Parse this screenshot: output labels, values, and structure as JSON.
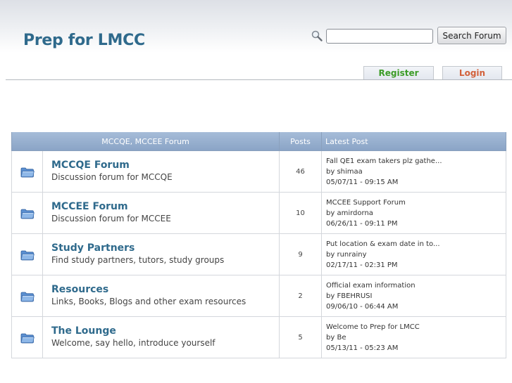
{
  "header": {
    "site_title": "Prep for LMCC",
    "search": {
      "placeholder": "",
      "value": "",
      "button_label": "Search Forum"
    },
    "nav": {
      "register_label": "Register",
      "login_label": "Login"
    }
  },
  "forum_table": {
    "columns": {
      "forum": "MCCQE, MCCEE Forum",
      "posts": "Posts",
      "latest": "Latest Post"
    },
    "rows": [
      {
        "name": "MCCQE Forum",
        "description": "Discussion forum for MCCQE",
        "posts": "46",
        "latest": {
          "title": "Fall QE1 exam takers plz gathe...",
          "author": "by shimaa",
          "datetime": "05/07/11 - 09:15 AM"
        }
      },
      {
        "name": "MCCEE Forum",
        "description": "Discussion forum for MCCEE",
        "posts": "10",
        "latest": {
          "title": "MCCEE Support Forum",
          "author": "by amirdorna",
          "datetime": "06/26/11 - 09:11 PM"
        }
      },
      {
        "name": "Study Partners",
        "description": "Find study partners, tutors, study groups",
        "posts": "9",
        "latest": {
          "title": "Put location & exam date in to...",
          "author": "by runrainy",
          "datetime": "02/17/11 - 02:31 PM"
        }
      },
      {
        "name": "Resources",
        "description": "Links, Books, Blogs and other exam resources",
        "posts": "2",
        "latest": {
          "title": "Official exam information",
          "author": "by FBEHRUSI",
          "datetime": "09/06/10 - 06:44 AM"
        }
      },
      {
        "name": "The Lounge",
        "description": "Welcome, say hello, introduce yourself",
        "posts": "5",
        "latest": {
          "title": "Welcome to Prep for LMCC",
          "author": "by Be",
          "datetime": "05/13/11 - 05:23 AM"
        }
      }
    ]
  },
  "colors": {
    "title_blue": "#2f6a8c",
    "register_green": "#3c9c27",
    "login_orange": "#d2603a",
    "header_bar": "#95aecd"
  },
  "icons": {
    "search": "magnifier-icon",
    "forum": "folder-icon"
  }
}
